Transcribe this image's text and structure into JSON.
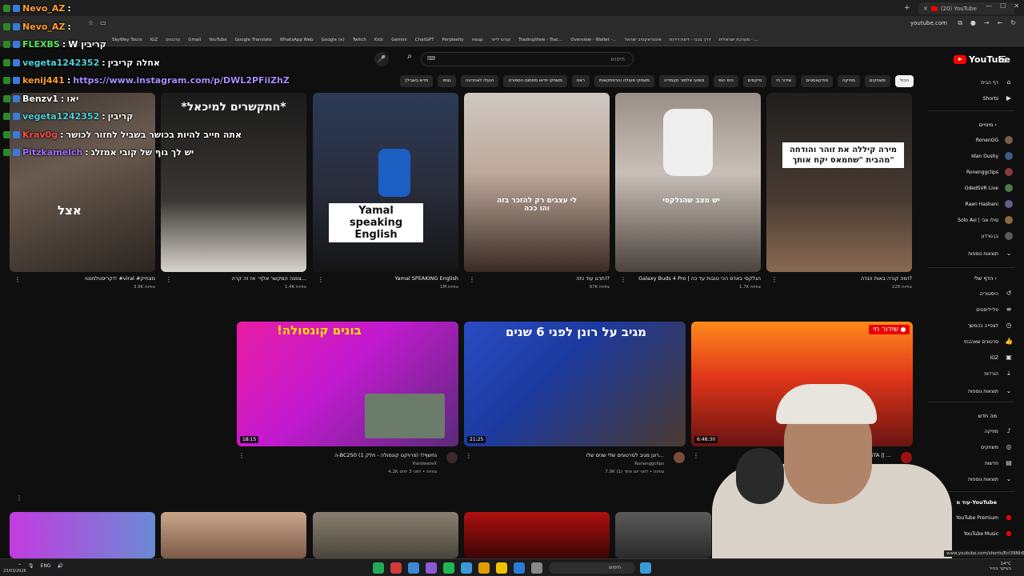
{
  "browser": {
    "tab_title": "(20) YouTube",
    "url": "youtube.com",
    "bookmarks": [
      "SkyWay Tours",
      "IGZ",
      "עדכונים",
      "Gmail",
      "YouTube",
      "Google Translate",
      "WhatsApp Web",
      "Google (א)",
      "Twitch",
      "Kick",
      "Gemini",
      "ChatGPT",
      "Perplexity",
      "neup",
      "קורס לייזר",
      "TradingView - Trac...",
      "Overview - Wallet -...",
      "אינטראקטיב ישראל",
      "דרך בכבי - דיווח דירות",
      "מערכת ישראלית - ..."
    ]
  },
  "header": {
    "logo_text": "YouTube",
    "search_placeholder": "חיפוש"
  },
  "chips": [
    {
      "label": "הכול",
      "active": true
    },
    {
      "label": "משחקים",
      "active": false
    },
    {
      "label": "מוזיקה",
      "active": false
    },
    {
      "label": "פודקאסטים",
      "active": false
    },
    {
      "label": "שידור חי",
      "active": false
    },
    {
      "label": "מיקסים",
      "active": false
    },
    {
      "label": "היפ הופ",
      "active": false
    },
    {
      "label": "מופעי אלתור וקומדיה",
      "active": false
    },
    {
      "label": "משחקי פעולה והרפתקאות",
      "active": false
    },
    {
      "label": "ראפ",
      "active": false
    },
    {
      "label": "משחקי וידאו מתחום הספורט",
      "active": false
    },
    {
      "label": "הועלו לאחרונה",
      "active": false
    },
    {
      "label": "נצפו",
      "active": false
    },
    {
      "label": "חדש בשבילך",
      "active": false
    }
  ],
  "sidebar": {
    "home": "דף הבית",
    "shorts": "Shorts",
    "subs_header": "מינויים",
    "subscriptions": [
      "RonenGG",
      "Idan Dushy",
      "Ronenggclips",
      "OdedSVR Live",
      "Raen Hasbani",
      "Solo Avi | סולו אבי",
      "בן גורדון"
    ],
    "show_more": "תוצאות נוספות",
    "you_header": "הדף שלי",
    "you_items": [
      "היסטוריה",
      "פלייליסטים",
      "לצפייה בהמשך",
      "סרטונים שאהבתי",
      "IGZ",
      "הורדות"
    ],
    "show_more_2": "תוצאות נוספות",
    "explore_header": "מה חדש",
    "explore_items": [
      "מוזיקה",
      "משחקים",
      "חדשות"
    ],
    "show_more_3": "תוצאות נוספות",
    "more_header": "עוד מ-YouTube",
    "more_items": [
      "YouTube Premium",
      "YouTube Music"
    ]
  },
  "row1": [
    {
      "title": "קריסטלמנטו!! #viral #מצחיק",
      "meta": "3.9K צפיות",
      "overlay": "אצל"
    },
    {
      "title": "צפגה המקשר אלף׳ אז זה קרה...",
      "meta": "1.4K צפיות",
      "overlay": "*חתקשרים למיכאל*"
    },
    {
      "title": "Yamal SPEAKING English",
      "meta": "1M צפיות",
      "overlay": "Yamal speaking English"
    },
    {
      "title": "תרגו עוד כזה!?",
      "meta": "97K צפיות",
      "overlay": "לי עצבים רק להזכר בזה והו ככה"
    },
    {
      "title": "Galaxy Buds 4 Pro | הגלקסי באדס הכי טובות עד כה",
      "meta": "1.7K צפיות",
      "overlay": "יש מצב שהגלקסי"
    },
    {
      "title": "מה קורה באות הגדה!?",
      "meta": "228 צפיות",
      "overlay": "מירה קיללה את זוהר והודחה מהבית \"שחמאס יקח אותך\""
    }
  ],
  "row2": [
    {
      "title": "ה-BC250 נחשף!! (פרויקט קונסולה - חלק 1)",
      "channel": "HardwareX",
      "meta": "4.2K צפיות • לפני 3 ימים",
      "duration": "18:15",
      "overlay": "!בונים קונסולה"
    },
    {
      "title": "רונן מגיב לסרטונים שלי שנים שלו...",
      "channel": "Ronenggclips",
      "meta": "7.9K צפיות • לפני יום אחד (1)",
      "duration": "21:25",
      "overlay": "מגיב על רונן לפני 6 שנים"
    },
    {
      "title": "LIVE || מרתון GTA || ...",
      "channel": "",
      "meta": "",
      "duration": "6:48:30",
      "overlay": "שידור חי"
    }
  ],
  "chat": [
    {
      "user": "Nevo_AZ",
      "message": "",
      "color": "#ff9f2e"
    },
    {
      "user": "Nevo_AZ",
      "message": "",
      "color": "#ff9f2e"
    },
    {
      "user": "FLEXBS",
      "message": "W קריבין",
      "color": "#5ee35e"
    },
    {
      "user": "vegeta1242352",
      "message": "אחלה קריבין",
      "color": "#4fd1d9"
    },
    {
      "user": "kenij441",
      "message": "https://www.instagram.com/p/DWL2PFiiZhZ",
      "color": "#ff9f2e"
    },
    {
      "user": "Benzv1",
      "message": "יאו",
      "color": "#ffffff"
    },
    {
      "user": "vegeta1242352",
      "message": "קריבין",
      "color": "#4fd1d9"
    },
    {
      "user": "Krav0g",
      "message": "אתה חייב להיות בכושר בשביל לחזור לכושר",
      "color": "#ff4b4b"
    },
    {
      "user": "Pitzkamelch",
      "message": "יש לך גוף של קובי אמזלג",
      "color": "#9e6bff"
    }
  ],
  "taskbar": {
    "search_placeholder": "חיפוש",
    "lang": "ENG",
    "clock": "23/03/2026",
    "weather": "14°C",
    "weather_desc": "בעיקר בהיר"
  },
  "status_url": "www.youtube.com/shorts/Ecl39Nh6Ns",
  "colors": {
    "bg": "#0f0f0f",
    "accent": "#ff0000"
  }
}
